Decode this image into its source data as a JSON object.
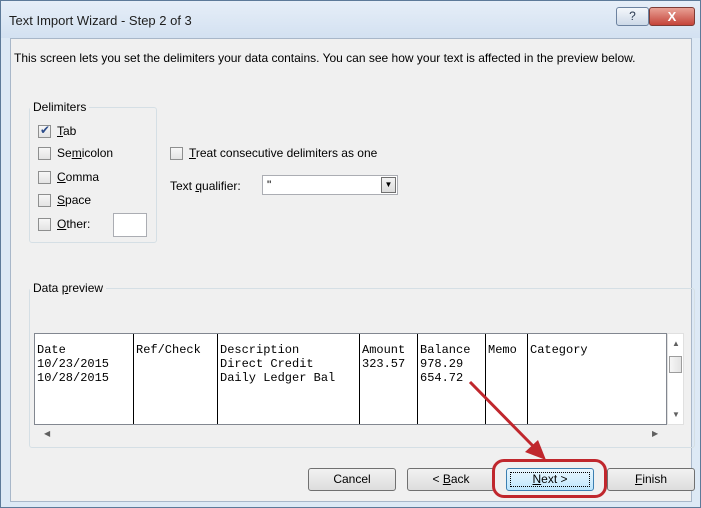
{
  "window": {
    "title": "Text Import Wizard - Step 2 of 3",
    "help_label": "?",
    "close_label": "X"
  },
  "intro": "This screen lets you set the delimiters your data contains.  You can see how your text is affected in the preview below.",
  "delimiters": {
    "label": "Delimiters",
    "tab": {
      "pre": "",
      "key": "T",
      "post": "ab",
      "checked": true
    },
    "semicolon": {
      "pre": "Se",
      "key": "m",
      "post": "icolon",
      "checked": false
    },
    "comma": {
      "pre": "",
      "key": "C",
      "post": "omma",
      "checked": false
    },
    "space": {
      "pre": "",
      "key": "S",
      "post": "pace",
      "checked": false
    },
    "other": {
      "pre": "",
      "key": "O",
      "post": "ther:",
      "checked": false,
      "value": ""
    }
  },
  "consecutive": {
    "pre": "",
    "key": "T",
    "post": "reat consecutive delimiters as one",
    "checked": false
  },
  "qualifier": {
    "pre": "Text ",
    "key": "q",
    "post": "ualifier:",
    "value": "\""
  },
  "preview": {
    "label_pre": "Data ",
    "label_key": "p",
    "label_post": "review",
    "columns": [
      {
        "header": "Date",
        "cells": [
          "10/23/2015",
          "10/28/2015"
        ]
      },
      {
        "header": "Ref/Check",
        "cells": [
          "",
          ""
        ]
      },
      {
        "header": "Description",
        "cells": [
          "Direct Credit",
          "Daily Ledger Bal"
        ]
      },
      {
        "header": "Amount",
        "cells": [
          "323.57",
          ""
        ]
      },
      {
        "header": "Balance",
        "cells": [
          "978.29",
          "654.72"
        ]
      },
      {
        "header": "Memo",
        "cells": [
          "",
          ""
        ]
      },
      {
        "header": "Category",
        "cells": [
          "",
          ""
        ]
      }
    ]
  },
  "buttons": {
    "cancel": "Cancel",
    "back": {
      "pre": "< ",
      "key": "B",
      "post": "ack"
    },
    "next": {
      "pre": "",
      "key": "N",
      "post": "ext >"
    },
    "finish": {
      "pre": "",
      "key": "F",
      "post": "inish"
    }
  },
  "colors": {
    "highlight": "#c0272d",
    "titlebar": "#dde9f5",
    "dialog": "#f0f0f0"
  }
}
